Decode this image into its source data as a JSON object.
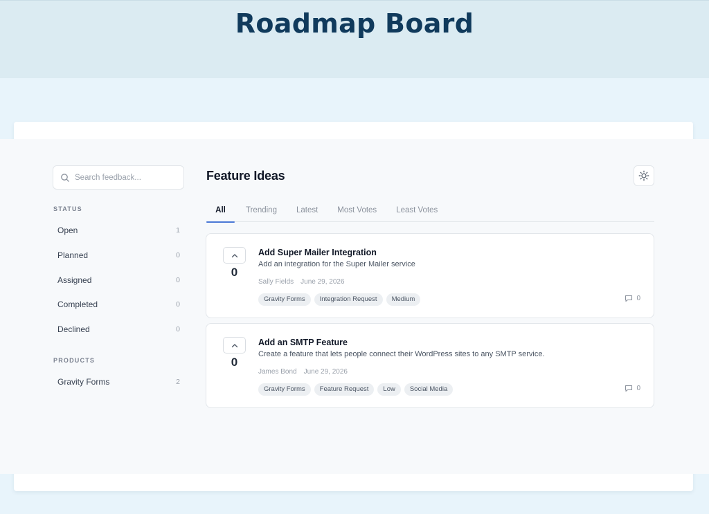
{
  "header": {
    "title": "Roadmap Board"
  },
  "search": {
    "placeholder": "Search feedback..."
  },
  "sidebar": {
    "status_label": "STATUS",
    "statuses": [
      {
        "label": "Open",
        "count": "1"
      },
      {
        "label": "Planned",
        "count": "0"
      },
      {
        "label": "Assigned",
        "count": "0"
      },
      {
        "label": "Completed",
        "count": "0"
      },
      {
        "label": "Declined",
        "count": "0"
      }
    ],
    "products_label": "PRODUCTS",
    "products": [
      {
        "label": "Gravity Forms",
        "count": "2"
      }
    ]
  },
  "main": {
    "title": "Feature Ideas",
    "tabs": [
      {
        "label": "All",
        "active": true
      },
      {
        "label": "Trending"
      },
      {
        "label": "Latest"
      },
      {
        "label": "Most Votes"
      },
      {
        "label": "Least Votes"
      }
    ],
    "ideas": [
      {
        "votes": "0",
        "title": "Add Super Mailer Integration",
        "description": "Add an integration for the Super Mailer service",
        "author": "Sally Fields",
        "date": "June 29, 2026",
        "tags": [
          "Gravity Forms",
          "Integration Request",
          "Medium"
        ],
        "comments": "0"
      },
      {
        "votes": "0",
        "title": "Add an SMTP Feature",
        "description": "Create a feature that lets people connect their WordPress sites to any SMTP service.",
        "author": "James Bond",
        "date": "June 29, 2026",
        "tags": [
          "Gravity Forms",
          "Feature Request",
          "Low",
          "Social Media"
        ],
        "comments": "0"
      }
    ]
  },
  "colors": {
    "title": "#103a5c",
    "accent": "#4a78d6",
    "background": "#e8f4fb",
    "header_band": "#dbebf2"
  },
  "icons": {
    "search": "search-icon",
    "theme": "sun-icon",
    "upvote": "chevron-up-icon",
    "comment": "comment-icon"
  }
}
